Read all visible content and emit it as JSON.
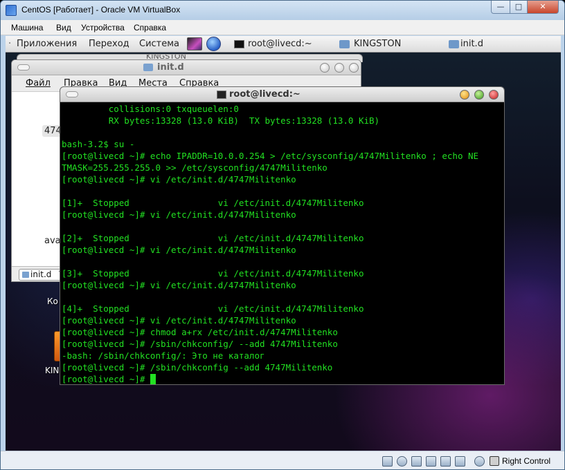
{
  "vbox": {
    "title": "CentOS [Работает] - Oracle VM VirtualBox",
    "min_glyph": "—",
    "max_glyph": "□",
    "close_glyph": "✕",
    "menu": [
      "Машина",
      "Вид",
      "Устройства",
      "Справка"
    ],
    "status": {
      "host_key_label": "Right Control"
    }
  },
  "guest_panel": {
    "menus": [
      "Приложения",
      "Переход",
      "Система"
    ],
    "separator": "·",
    "tasks": [
      "root@livecd:~",
      "KINGSTON",
      "init.d"
    ]
  },
  "kingston_window": {
    "title": "KINGSTON"
  },
  "file_manager": {
    "title": "init.d",
    "menu": [
      "Файл",
      "Правка",
      "Вид",
      "Места",
      "Справка"
    ],
    "items": [
      "4747",
      "avah"
    ],
    "location_combo": "init.d",
    "combo_arrow": "▾"
  },
  "desktop": {
    "labels": [
      "Ко",
      "KIN"
    ]
  },
  "terminal": {
    "title": "root@livecd:~",
    "lines": [
      "         collisions:0 txqueuelen:0",
      "         RX bytes:13328 (13.0 KiB)  TX bytes:13328 (13.0 KiB)",
      "",
      "bash-3.2$ su -",
      "[root@livecd ~]# echo IPADDR=10.0.0.254 > /etc/sysconfig/4747Militenko ; echo NE",
      "TMASK=255.255.255.0 >> /etc/sysconfig/4747Militenko",
      "[root@livecd ~]# vi /etc/init.d/4747Militenko",
      "",
      "[1]+  Stopped                 vi /etc/init.d/4747Militenko",
      "[root@livecd ~]# vi /etc/init.d/4747Militenko",
      "",
      "[2]+  Stopped                 vi /etc/init.d/4747Militenko",
      "[root@livecd ~]# vi /etc/init.d/4747Militenko",
      "",
      "[3]+  Stopped                 vi /etc/init.d/4747Militenko",
      "[root@livecd ~]# vi /etc/init.d/4747Militenko",
      "",
      "[4]+  Stopped                 vi /etc/init.d/4747Militenko",
      "[root@livecd ~]# vi /etc/init.d/4747Militenko",
      "[root@livecd ~]# chmod a+rx /etc/init.d/4747Militenko",
      "[root@livecd ~]# /sbin/chkconfig/ --add 4747Militenko",
      "-bash: /sbin/chkconfig/: Это не каталог",
      "[root@livecd ~]# /sbin/chkconfig --add 4747Militenko"
    ],
    "prompt": "[root@livecd ~]# "
  }
}
